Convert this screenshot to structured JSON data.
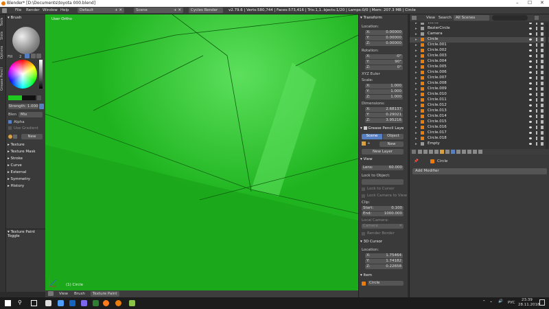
{
  "window": {
    "title": "Blender* [D:\\Documents\\toyota 000.blend]"
  },
  "infobar": {
    "menus": [
      "File",
      "Render",
      "Window",
      "Help"
    ],
    "layout": "Default",
    "scene": "Scene",
    "engine": "Cycles Render",
    "stats": "v2.79.6 | Verts:580,744 | Faces:573,416 | Tris:1,1..bjects:1/20 | Lamps:0/0 | Mem: 207.3 MB | Circle"
  },
  "tool_tabs": [
    "Tools",
    "Slots",
    "Options",
    "Grease Pencil"
  ],
  "toolshelf": {
    "brush_header": "Brush",
    "fill_label": "Fill",
    "fill_num": "2",
    "strength_label": "Strength: 1.000",
    "blend_label": "Blen",
    "blend_value": "Mix",
    "alpha_label": "Alpha",
    "gradient_label": "Use Gradient",
    "new_label": "New",
    "sections": [
      "Texture",
      "Texture Mask",
      "Stroke",
      "Curve",
      "External",
      "Symmetry",
      "History"
    ],
    "toggle_label": "Texture Paint Toggle"
  },
  "viewport": {
    "corner_label": "User Ortho",
    "object_label": "(1) Circle",
    "color_main": "#1fb41f",
    "color_light": "#5de05d",
    "color_dark": "#179e17"
  },
  "viewport_bar": {
    "items": [
      "View",
      "Brush",
      "Texture Paint"
    ]
  },
  "props": {
    "transform_header": "Transform",
    "location_label": "Location:",
    "location": [
      {
        "k": "X:",
        "v": "0.00000"
      },
      {
        "k": "Y:",
        "v": "0.00000"
      },
      {
        "k": "Z:",
        "v": "0.00000"
      }
    ],
    "rotation_label": "Rotation:",
    "rotation": [
      {
        "k": "X:",
        "v": "-0°"
      },
      {
        "k": "Y:",
        "v": "90°"
      },
      {
        "k": "Z:",
        "v": "0°"
      }
    ],
    "euler": "XYZ Euler",
    "scale_label": "Scale:",
    "scale": [
      {
        "k": "X:",
        "v": "1.000"
      },
      {
        "k": "Y:",
        "v": "1.000"
      },
      {
        "k": "Z:",
        "v": "1.000"
      }
    ],
    "dimensions_label": "Dimensions:",
    "dimensions": [
      {
        "k": "X:",
        "v": "2.68137"
      },
      {
        "k": "Y:",
        "v": "0.29021"
      },
      {
        "k": "Z:",
        "v": "3.95216"
      }
    ],
    "grease_header": "Grease Pencil Laye",
    "scene_tab": "Scene",
    "object_tab": "Object",
    "new_label": "New",
    "new_layer": "New Layer",
    "view_header": "View",
    "lens": {
      "k": "Lens:",
      "v": "60.000"
    },
    "lock_label": "Lock to Object:",
    "lock_cursor": "Lock to Cursor",
    "lock_camera": "Lock Camera to View",
    "clip_label": "Clip:",
    "clip_start": {
      "k": "Start:",
      "v": "0.100"
    },
    "clip_end": {
      "k": "End:",
      "v": "1000.000"
    },
    "local_camera": "Local Camera:",
    "camera_value": "Camera",
    "render_border": "Render Border",
    "cursor_header": "3D Cursor",
    "cursor_location": "Location:",
    "cursor": [
      {
        "k": "X:",
        "v": "1.75464"
      },
      {
        "k": "Y:",
        "v": "1.74182"
      },
      {
        "k": "Z:",
        "v": "0.22658"
      }
    ],
    "item_header": "Item",
    "item_value": "Circle"
  },
  "outliner": {
    "view": "View",
    "search": "Search",
    "scenes": "All Scenes",
    "items": [
      "World",
      "BezierCircle",
      "Camera",
      "Circle",
      "Circle.001",
      "Circle.002",
      "Circle.003",
      "Circle.004",
      "Circle.005",
      "Circle.006",
      "Circle.007",
      "Circle.008",
      "Circle.009",
      "Circle.010",
      "Circle.011",
      "Circle.012",
      "Circle.013",
      "Circle.014",
      "Circle.015",
      "Circle.016",
      "Circle.017",
      "Circle.018",
      "Empty"
    ]
  },
  "properties_editor": {
    "object": "Circle",
    "add_modifier": "Add Modifier"
  },
  "taskbar": {
    "lang": "РУС",
    "time": "23:39",
    "date": "28.11.2018"
  }
}
